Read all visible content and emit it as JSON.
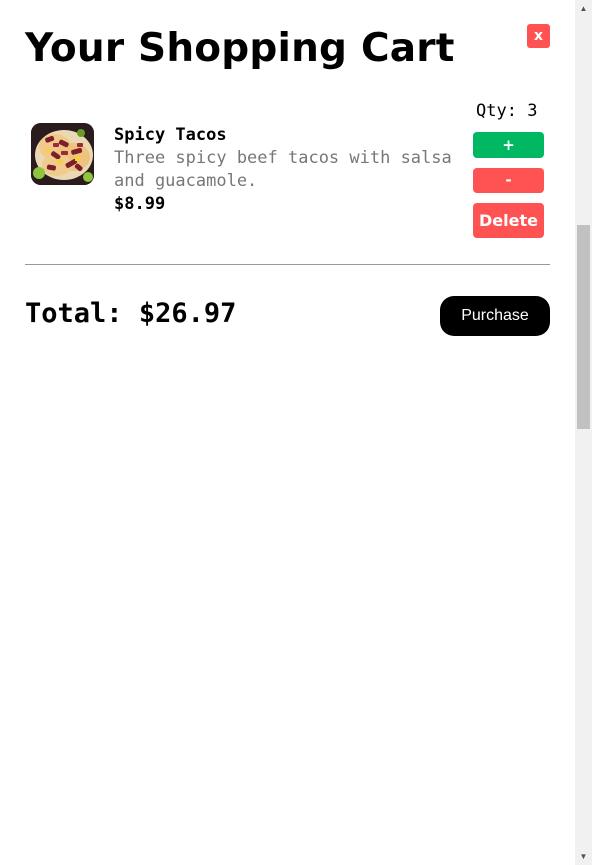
{
  "header": {
    "title": "Your Shopping Cart",
    "close_label": "x"
  },
  "cart": {
    "items": [
      {
        "name": "Spicy Tacos",
        "description": "Three spicy beef tacos with salsa and guacamole.",
        "price": "$8.99",
        "qty_label": "Qty:",
        "qty_value": "3",
        "image_icon": "tacos-photo",
        "plus_label": "+",
        "minus_label": "-",
        "delete_label": "Delete"
      }
    ]
  },
  "footer": {
    "total_label": "Total:",
    "total_value": "$26.97",
    "purchase_label": "Purchase"
  },
  "colors": {
    "accent_red": "#ff5252",
    "accent_green": "#00b862",
    "purchase_bg": "#000000"
  }
}
